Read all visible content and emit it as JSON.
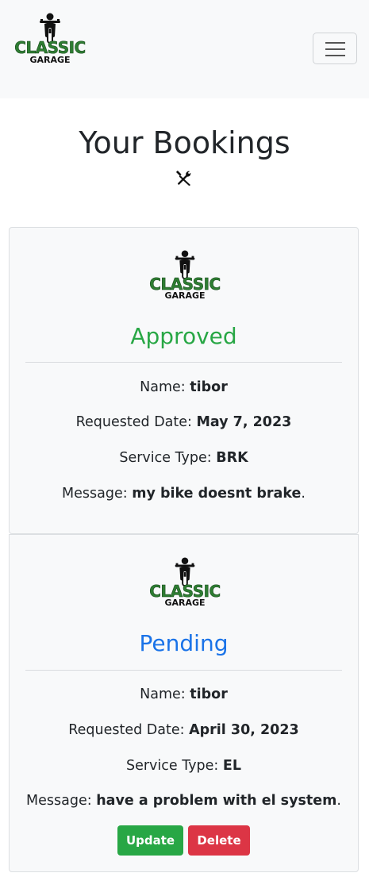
{
  "brand": {
    "line1": "CLASSIC",
    "line2": "GARAGE",
    "icon": "motorcycle-rider-icon"
  },
  "navbar": {
    "toggler_icon": "hamburger-menu-icon"
  },
  "page": {
    "title": "Your Bookings",
    "title_icon": "tools-icon"
  },
  "labels": {
    "name": "Name:",
    "requested_date": "Requested Date:",
    "service_type": "Service Type:",
    "message": "Message:"
  },
  "bookings": [
    {
      "status": "Approved",
      "status_color": "#28a745",
      "name": "tibor",
      "requested_date": "May 7, 2023",
      "service_type": "BRK",
      "message": "my bike doesnt brake",
      "message_suffix": "."
    },
    {
      "status": "Pending",
      "status_color": "#1a73e8",
      "name": "tibor",
      "requested_date": "April 30, 2023",
      "service_type": "EL",
      "message": "have a problem with el system",
      "message_suffix": ".",
      "actions": {
        "update_label": "Update",
        "delete_label": "Delete"
      }
    }
  ],
  "colors": {
    "primary_green": "#2e7d32",
    "update": "#28a745",
    "delete": "#dc3545"
  }
}
